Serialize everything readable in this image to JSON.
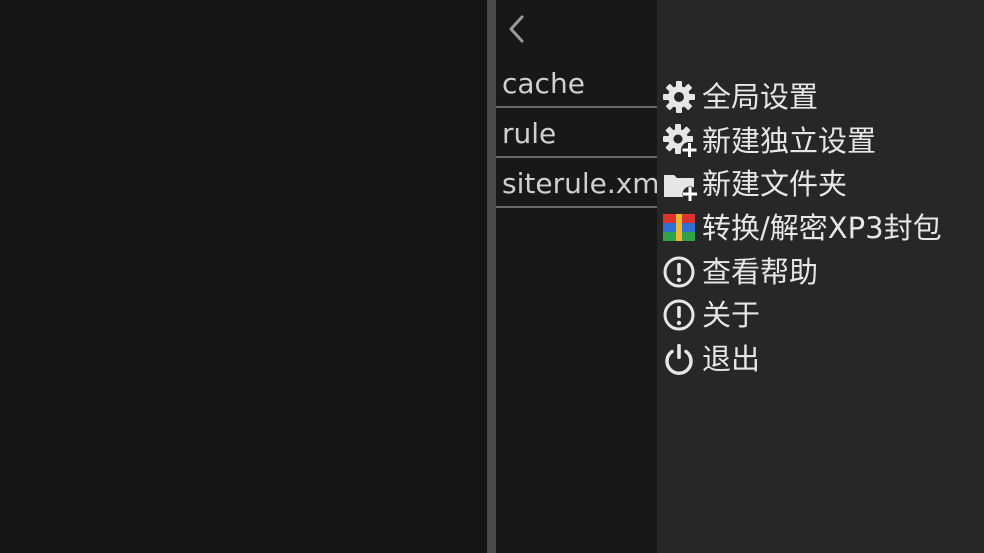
{
  "files": {
    "back_icon": "chevron-left-icon",
    "items": [
      {
        "name": "cache"
      },
      {
        "name": "rule"
      },
      {
        "name": "siterule.xml"
      }
    ]
  },
  "menu": {
    "items": [
      {
        "label": "全局设置",
        "icon": "gear-icon"
      },
      {
        "label": "新建独立设置",
        "icon": "gear-plus-icon"
      },
      {
        "label": "新建文件夹",
        "icon": "folder-plus-icon"
      },
      {
        "label": "转换/解密XP3封包",
        "icon": "archive-icon"
      },
      {
        "label": "查看帮助",
        "icon": "exclamation-circle-icon"
      },
      {
        "label": "关于",
        "icon": "exclamation-circle-icon"
      },
      {
        "label": "退出",
        "icon": "power-icon"
      }
    ]
  },
  "colors": {
    "background": "#151515",
    "divider": "#4a4a4a",
    "menu_background": "#272727",
    "text": "#e6e6e6",
    "file_text": "#cfcfcf"
  }
}
